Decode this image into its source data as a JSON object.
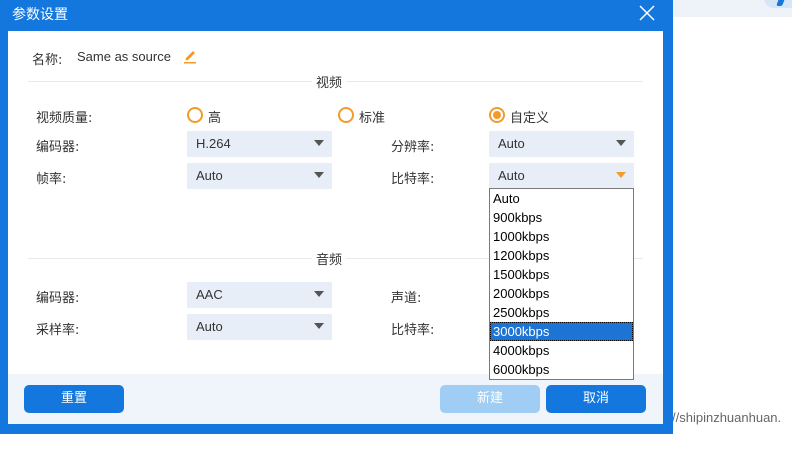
{
  "background": {
    "url_fragment": "//shipinzhuanhuan."
  },
  "dialog": {
    "title": "参数设置",
    "name_label": "名称:",
    "name_value": "Same as source",
    "video": {
      "section_title": "视频",
      "quality_label": "视频质量:",
      "quality_options": [
        "高",
        "标准",
        "自定义"
      ],
      "quality_selected": "自定义",
      "encoder_label": "编码器:",
      "encoder_value": "H.264",
      "resolution_label": "分辨率:",
      "resolution_value": "Auto",
      "framerate_label": "帧率:",
      "framerate_value": "Auto",
      "bitrate_label": "比特率:",
      "bitrate_value": "Auto"
    },
    "audio": {
      "section_title": "音频",
      "encoder_label": "编码器:",
      "encoder_value": "AAC",
      "channel_label": "声道:",
      "samplerate_label": "采样率:",
      "samplerate_value": "Auto",
      "bitrate_label": "比特率:"
    },
    "bitrate_dropdown": {
      "options": [
        "Auto",
        "900kbps",
        "1000kbps",
        "1200kbps",
        "1500kbps",
        "2000kbps",
        "2500kbps",
        "3000kbps",
        "4000kbps",
        "6000kbps"
      ],
      "highlighted": "3000kbps"
    },
    "buttons": {
      "reset": "重置",
      "new": "新建",
      "cancel": "取消"
    }
  },
  "colors": {
    "primary": "#1477de",
    "accent": "#f39a2a",
    "disabled": "#9fcdf3",
    "select_bg": "#e7eef7",
    "highlight": "#1e74d4"
  },
  "icons": {
    "close": "close-icon",
    "edit": "pencil-icon",
    "dropdown": "chevron-down-icon"
  }
}
